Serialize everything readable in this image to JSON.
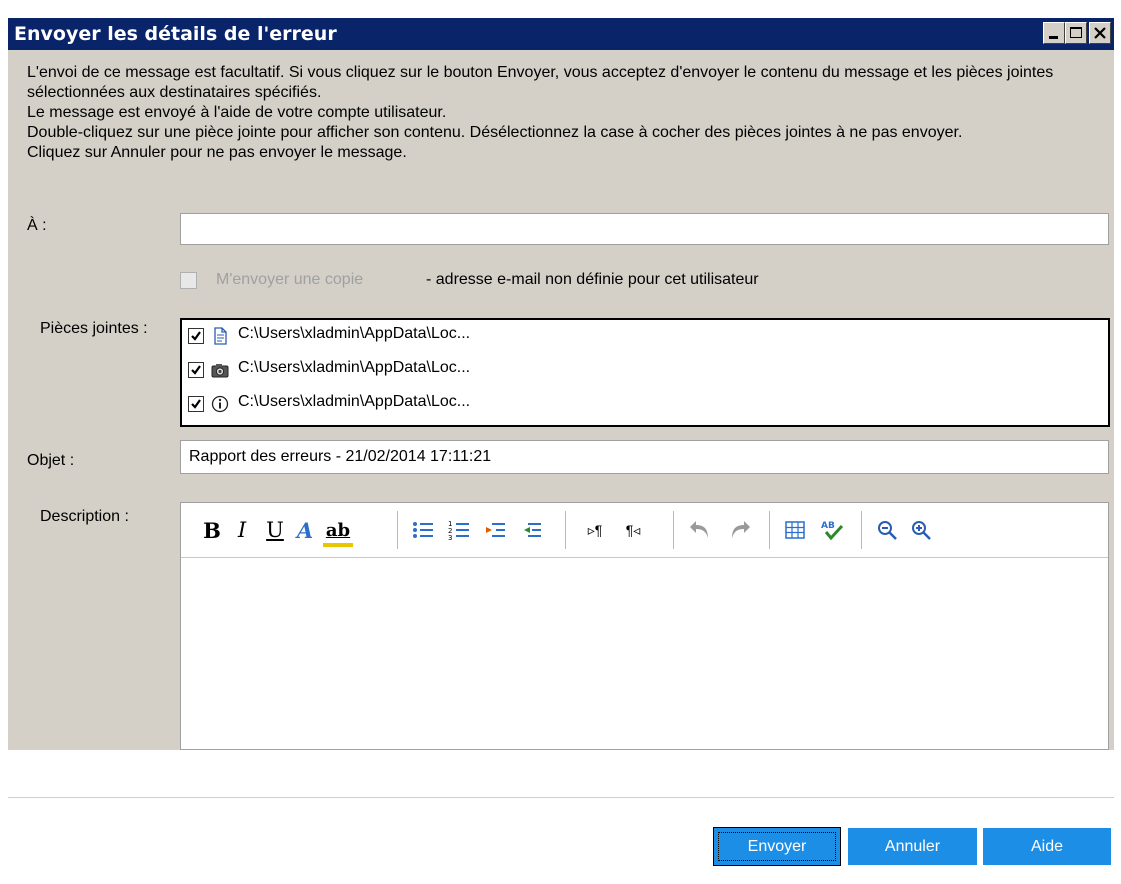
{
  "window": {
    "title": "Envoyer les détails de l'erreur",
    "controls": [
      "minimize-icon",
      "maximize-icon",
      "close-icon"
    ]
  },
  "intro": {
    "lines": [
      "L'envoi de ce message est facultatif. Si vous cliquez sur le bouton Envoyer, vous acceptez d'envoyer le contenu du message et les pièces jointes sélectionnées aux destinataires spécifiés.",
      "Le message est envoyé à l'aide de votre compte utilisateur.",
      "Double-cliquez sur une pièce jointe pour afficher son contenu. Désélectionnez la case à cocher des pièces jointes à ne pas envoyer.",
      "Cliquez sur Annuler pour ne pas envoyer le message."
    ]
  },
  "to": {
    "label": "À :",
    "value": ""
  },
  "copy": {
    "checked": false,
    "enabled": false,
    "label": "M'envoyer une copie",
    "note": "- adresse e-mail non définie pour cet utilisateur"
  },
  "attachments": {
    "label": "Pièces jointes :",
    "items": [
      {
        "checked": true,
        "icon": "document-icon",
        "path": "C:\\Users\\xladmin\\AppData\\Loc..."
      },
      {
        "checked": true,
        "icon": "camera-icon",
        "path": "C:\\Users\\xladmin\\AppData\\Loc..."
      },
      {
        "checked": true,
        "icon": "info-icon",
        "path": "C:\\Users\\xladmin\\AppData\\Loc..."
      }
    ]
  },
  "subject": {
    "label": "Objet :",
    "value": "Rapport des erreurs - 21/02/2014 17:11:21"
  },
  "description": {
    "label": "Description :",
    "toolbar": {
      "bold": "B",
      "italic": "I",
      "underline": "U",
      "font_color": "A",
      "highlight": "ab",
      "icons": [
        "bullet-list-icon",
        "numbered-list-icon",
        "indent-icon",
        "outdent-icon",
        "ltr-icon",
        "rtl-icon",
        "undo-icon",
        "redo-icon",
        "table-icon",
        "spellcheck-icon",
        "zoom-out-icon",
        "zoom-in-icon"
      ],
      "ltr_glyph": "▹¶",
      "rtl_glyph": "¶◃"
    },
    "value": ""
  },
  "buttons": {
    "send": "Envoyer",
    "cancel": "Annuler",
    "help": "Aide"
  },
  "colors": {
    "titlebar": "#0a246a",
    "dialog_bg": "#d4d0c8",
    "button_blue": "#1c8ee6"
  }
}
